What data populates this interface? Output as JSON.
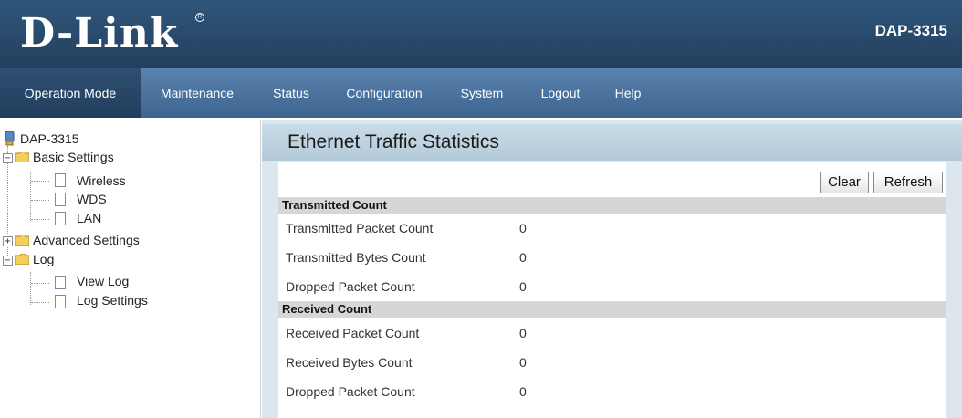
{
  "header": {
    "logo": "D-Link",
    "model": "DAP-3315"
  },
  "nav": {
    "items": [
      {
        "label": "Operation Mode"
      },
      {
        "label": "Maintenance"
      },
      {
        "label": "Status"
      },
      {
        "label": "Configuration"
      },
      {
        "label": "System"
      },
      {
        "label": "Logout"
      },
      {
        "label": "Help"
      }
    ]
  },
  "tree": {
    "root": "DAP-3315",
    "basic": "Basic Settings",
    "wireless": "Wireless",
    "wds": "WDS",
    "lan": "LAN",
    "advanced": "Advanced Settings",
    "log": "Log",
    "view_log": "View Log",
    "log_settings": "Log Settings"
  },
  "page": {
    "title": "Ethernet Traffic Statistics",
    "clear_label": "Clear",
    "refresh_label": "Refresh",
    "transmitted": {
      "heading": "Transmitted Count",
      "rows": [
        {
          "label": "Transmitted Packet Count",
          "value": "0"
        },
        {
          "label": "Transmitted Bytes Count",
          "value": "0"
        },
        {
          "label": "Dropped Packet Count",
          "value": "0"
        }
      ]
    },
    "received": {
      "heading": "Received Count",
      "rows": [
        {
          "label": "Received Packet Count",
          "value": "0"
        },
        {
          "label": "Received Bytes Count",
          "value": "0"
        },
        {
          "label": "Dropped Packet Count",
          "value": "0"
        }
      ]
    }
  },
  "colors": {
    "header": "#2f577b",
    "nav": "#4b729c",
    "content_bg": "#dbe6ee",
    "section_bg": "#d6d6d6"
  },
  "icons": {
    "root": "access-point-icon",
    "folder": "folder-icon",
    "page": "page-icon",
    "expand": "plus-box-icon",
    "collapse": "minus-box-icon"
  }
}
